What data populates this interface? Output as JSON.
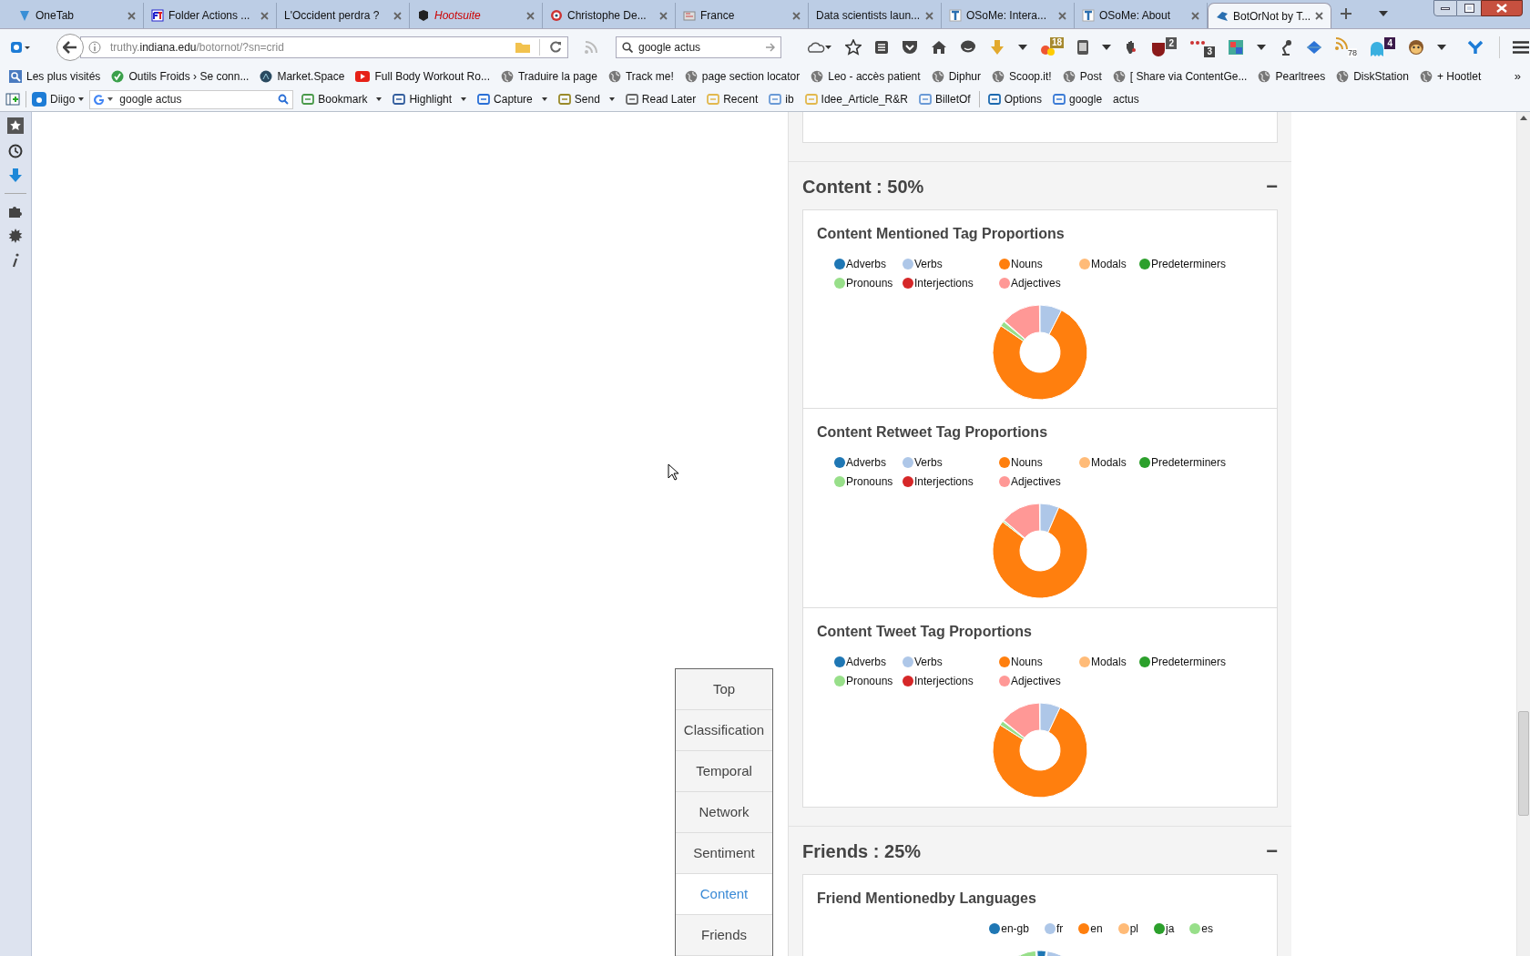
{
  "tabs": [
    {
      "label": "OneTab",
      "selected": false,
      "highlighted": false
    },
    {
      "label": "Folder Actions ...",
      "selected": false,
      "highlighted": false
    },
    {
      "label": "L'Occident perdra ?",
      "selected": false,
      "highlighted": false
    },
    {
      "label": "Hootsuite",
      "selected": false,
      "highlighted": true
    },
    {
      "label": "Christophe De...",
      "selected": false,
      "highlighted": false
    },
    {
      "label": "France",
      "selected": false,
      "highlighted": false
    },
    {
      "label": "Data scientists laun...",
      "selected": false,
      "highlighted": false
    },
    {
      "label": "OSoMe: Intera...",
      "selected": false,
      "highlighted": false
    },
    {
      "label": "OSoMe: About",
      "selected": false,
      "highlighted": false
    },
    {
      "label": "BotOrNot by T...",
      "selected": true,
      "highlighted": false
    }
  ],
  "address_bar": {
    "host_prefix": "truthy.",
    "domain": "indiana.edu",
    "path": "/botornot/?sn=crid"
  },
  "search_field": {
    "value": "google actus"
  },
  "toolbar_badges": [
    "18",
    "2",
    "3",
    "78",
    "4"
  ],
  "bookmarks": [
    "Les plus visités",
    "Outils Froids › Se conn...",
    "Market.Space",
    "Full Body Workout Ro...",
    "Traduire la page",
    "Track me!",
    "page section locator",
    "Leo - accès patient",
    "Diphur",
    "Scoop.it!",
    "Post",
    "[ Share via ContentGe...",
    "Pearltrees",
    "DiskStation",
    "+ Hootlet"
  ],
  "bookmarks_overflow": "»",
  "diigo_bar": {
    "menu": "Diigo",
    "search_value": "google actus",
    "items": [
      {
        "label": "Bookmark",
        "dropdown": true
      },
      {
        "label": "Highlight",
        "dropdown": true
      },
      {
        "label": "Capture",
        "dropdown": true
      },
      {
        "label": "Send",
        "dropdown": true
      },
      {
        "label": "Read Later",
        "dropdown": false
      },
      {
        "label": "Recent",
        "dropdown": false
      },
      {
        "label": "ib",
        "dropdown": false
      },
      {
        "label": "Idee_Article_R&R",
        "dropdown": false
      },
      {
        "label": "BilletOf",
        "dropdown": false
      },
      {
        "label": "Options",
        "dropdown": false
      },
      {
        "label": "google",
        "dropdown": false
      },
      {
        "label": "actus",
        "dropdown": false
      }
    ]
  },
  "section_nav": [
    {
      "label": "Top",
      "selected": false
    },
    {
      "label": "Classification",
      "selected": false
    },
    {
      "label": "Temporal",
      "selected": false
    },
    {
      "label": "Network",
      "selected": false
    },
    {
      "label": "Sentiment",
      "selected": false
    },
    {
      "label": "Content",
      "selected": true
    },
    {
      "label": "Friends",
      "selected": false
    }
  ],
  "sections": [
    {
      "title": "Content : 50%",
      "collapse": "−",
      "cards": [
        {
          "title": "Content Mentioned Tag Proportions",
          "kind": "tags",
          "legend": [
            {
              "label": "Adverbs",
              "color": "#1f77b4"
            },
            {
              "label": "Verbs",
              "color": "#aec7e8"
            },
            {
              "label": "Nouns",
              "color": "#ff7f0e"
            },
            {
              "label": "Modals",
              "color": "#ffbb78"
            },
            {
              "label": "Predeterminers",
              "color": "#2ca02c"
            },
            {
              "label": "Pronouns",
              "color": "#98df8a"
            },
            {
              "label": "Interjections",
              "color": "#d62728"
            },
            {
              "label": "Adjectives",
              "color": "#ff9896"
            }
          ]
        },
        {
          "title": "Content Retweet Tag Proportions",
          "kind": "tags",
          "legend": [
            {
              "label": "Adverbs",
              "color": "#1f77b4"
            },
            {
              "label": "Verbs",
              "color": "#aec7e8"
            },
            {
              "label": "Nouns",
              "color": "#ff7f0e"
            },
            {
              "label": "Modals",
              "color": "#ffbb78"
            },
            {
              "label": "Predeterminers",
              "color": "#2ca02c"
            },
            {
              "label": "Pronouns",
              "color": "#98df8a"
            },
            {
              "label": "Interjections",
              "color": "#d62728"
            },
            {
              "label": "Adjectives",
              "color": "#ff9896"
            }
          ]
        },
        {
          "title": "Content Tweet Tag Proportions",
          "kind": "tags",
          "legend": [
            {
              "label": "Adverbs",
              "color": "#1f77b4"
            },
            {
              "label": "Verbs",
              "color": "#aec7e8"
            },
            {
              "label": "Nouns",
              "color": "#ff7f0e"
            },
            {
              "label": "Modals",
              "color": "#ffbb78"
            },
            {
              "label": "Predeterminers",
              "color": "#2ca02c"
            },
            {
              "label": "Pronouns",
              "color": "#98df8a"
            },
            {
              "label": "Interjections",
              "color": "#d62728"
            },
            {
              "label": "Adjectives",
              "color": "#ff9896"
            }
          ]
        }
      ]
    },
    {
      "title": "Friends : 25%",
      "collapse": "−",
      "cards": [
        {
          "title": "Friend Mentionedby Languages",
          "kind": "languages",
          "legend": [
            {
              "label": "en-gb",
              "color": "#1f77b4"
            },
            {
              "label": "fr",
              "color": "#aec7e8"
            },
            {
              "label": "en",
              "color": "#ff7f0e"
            },
            {
              "label": "pl",
              "color": "#ffbb78"
            },
            {
              "label": "ja",
              "color": "#2ca02c"
            },
            {
              "label": "es",
              "color": "#98df8a"
            }
          ]
        }
      ]
    }
  ]
}
